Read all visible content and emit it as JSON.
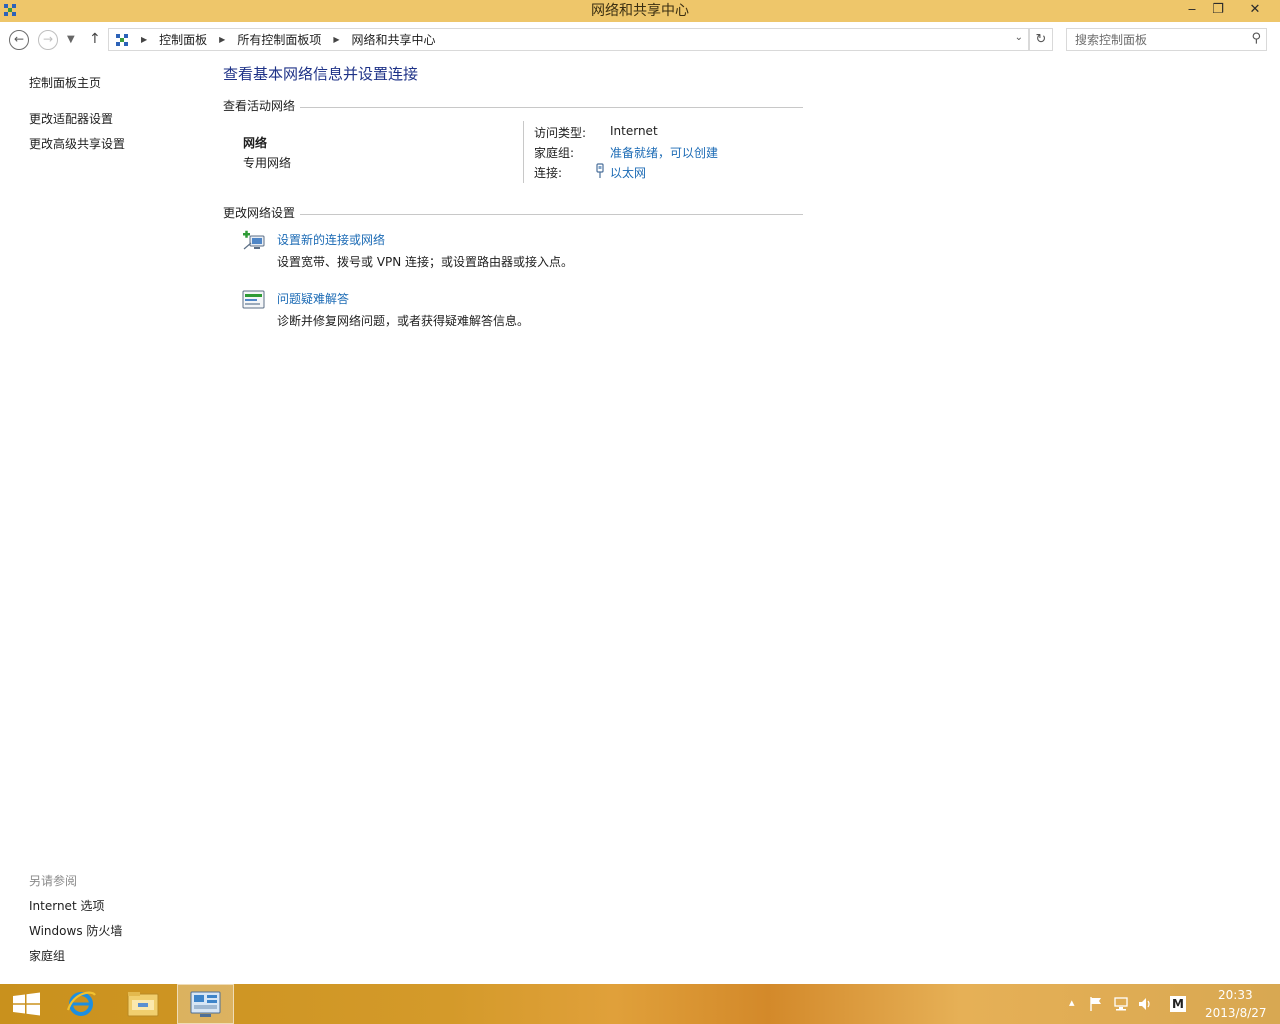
{
  "window": {
    "title": "网络和共享中心",
    "minimize_glyph": "‒",
    "restore_glyph": "❐",
    "close_glyph": "✕"
  },
  "navigation": {
    "breadcrumbs": [
      "控制面板",
      "所有控制面板项",
      "网络和共享中心"
    ],
    "search_placeholder": "搜索控制面板"
  },
  "sidebar": {
    "links": [
      "控制面板主页",
      "更改适配器设置",
      "更改高级共享设置"
    ],
    "see_also_title": "另请参阅",
    "see_also_links": [
      "Internet 选项",
      "Windows 防火墙",
      "家庭组"
    ]
  },
  "main": {
    "title": "查看基本网络信息并设置连接",
    "active_networks_heading": "查看活动网络",
    "network": {
      "name": "网络",
      "type": "专用网络",
      "access_type_label": "访问类型:",
      "access_type_value": "Internet",
      "homegroup_label": "家庭组:",
      "homegroup_value": "准备就绪，可以创建",
      "connection_label": "连接:",
      "connection_value": "以太网"
    },
    "change_settings_heading": "更改网络设置",
    "tasks": [
      {
        "title": "设置新的连接或网络",
        "description": "设置宽带、拨号或 VPN 连接；或设置路由器或接入点。",
        "icon": "new-connection-icon"
      },
      {
        "title": "问题疑难解答",
        "description": "诊断并修复网络问题，或者获得疑难解答信息。",
        "icon": "troubleshoot-icon"
      }
    ]
  },
  "taskbar": {
    "pinned": [
      "start-button",
      "internet-explorer-icon",
      "file-explorer-icon",
      "control-panel-icon"
    ],
    "time": "20:33",
    "date": "2013/8/27",
    "tray_icons": [
      "show-hidden-icons",
      "action-center-flag-icon",
      "network-icon",
      "volume-icon",
      "input-method-icon"
    ],
    "ime_label": "M"
  },
  "colors": {
    "titlebar": "#eec66a",
    "link": "#1c6bb5",
    "page_title": "#1e3287",
    "taskbar": "#d49a2a"
  }
}
